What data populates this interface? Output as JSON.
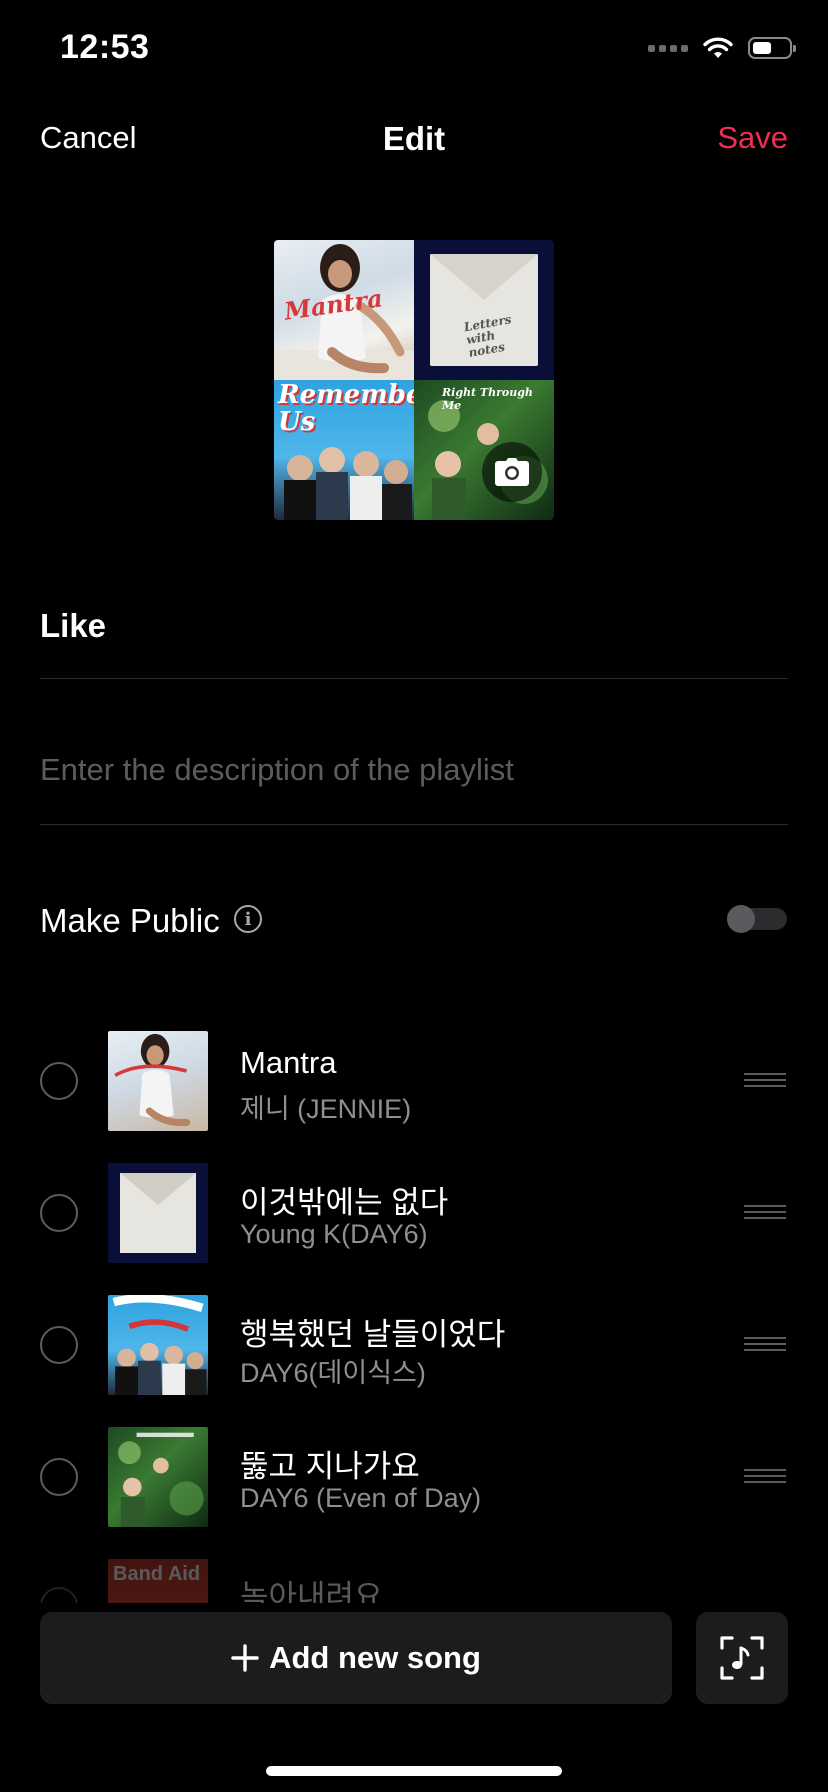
{
  "status_bar": {
    "time": "12:53"
  },
  "nav": {
    "cancel": "Cancel",
    "title": "Edit",
    "save": "Save"
  },
  "cover": {
    "tiles": [
      "Mantra album art",
      "Letters with notes album art",
      "Remember Us album art",
      "Right Through Me album art"
    ],
    "art_text": {
      "mantra": "Mantra",
      "letter": "Letters with notes",
      "remember": "Remember Us",
      "right": "Right Through Me"
    }
  },
  "playlist": {
    "title": "Like",
    "description_placeholder": "Enter the description of the playlist",
    "public_label": "Make Public",
    "public_enabled": false
  },
  "songs": [
    {
      "title": "Mantra",
      "artist": "제니 (JENNIE)"
    },
    {
      "title": "이것밖에는 없다",
      "artist": "Young K(DAY6)"
    },
    {
      "title": "행복했던 날들이었다",
      "artist": "DAY6(데이식스)"
    },
    {
      "title": "뚫고 지나가요",
      "artist": "DAY6 (Even of Day)"
    },
    {
      "title": "녹아내려요",
      "artist": "",
      "thumb_text": "Band Aid"
    }
  ],
  "actions": {
    "add_song": "Add new song"
  },
  "colors": {
    "accent": "#ee2f55",
    "background": "#000000",
    "button_bg": "#1c1c1e"
  },
  "icons": [
    "wifi-icon",
    "battery-icon",
    "camera-icon",
    "info-icon",
    "drag-handle-icon",
    "plus-icon",
    "music-scan-icon"
  ]
}
